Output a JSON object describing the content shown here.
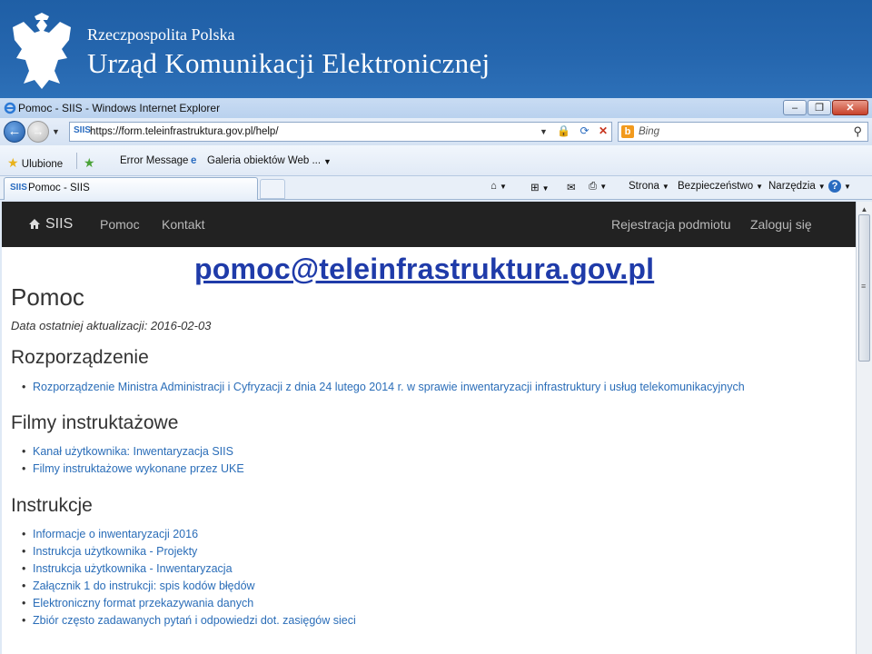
{
  "banner": {
    "subtitle": "Rzeczpospolita Polska",
    "title": "Urząd Komunikacji Elektronicznej"
  },
  "browser": {
    "window_title": "Pomoc - SIIS - Windows Internet Explorer",
    "address_url": "https://form.teleinfrastruktura.gov.pl/help/",
    "search_placeholder": "Bing",
    "favorites": {
      "label": "Ulubione",
      "items": [
        "Error Message",
        "Galeria obiektów Web ..."
      ]
    },
    "tab_title": "Pomoc - SIIS",
    "commands": [
      "Strona",
      "Bezpieczeństwo",
      "Narzędzia"
    ]
  },
  "site": {
    "nav": {
      "brand": "SIIS",
      "links": [
        "Pomoc",
        "Kontakt"
      ],
      "right_links": [
        "Rejestracja podmiotu",
        "Zaloguj się"
      ]
    },
    "callout_email": "pomoc@teleinfrastruktura.gov.pl",
    "heading": "Pomoc",
    "last_update": "Data ostatniej aktualizacji: 2016-02-03",
    "sections": [
      {
        "title": "Rozporządzenie",
        "links": [
          "Rozporządzenie Ministra Administracji i Cyfryzacji z dnia 24 lutego 2014 r. w sprawie inwentaryzacji infrastruktury i usług telekomunikacyjnych"
        ]
      },
      {
        "title": "Filmy instruktażowe",
        "links": [
          "Kanał użytkownika: Inwentaryzacja SIIS",
          "Filmy instruktażowe wykonane przez UKE"
        ]
      },
      {
        "title": "Instrukcje",
        "links": [
          "Informacje o inwentaryzacji 2016",
          "Instrukcja użytkownika - Projekty",
          "Instrukcja użytkownika - Inwentaryzacja",
          "Załącznik 1 do instrukcji: spis kodów błędów",
          "Elektroniczny format przekazywania danych",
          "Zbiór często zadawanych pytań i odpowiedzi dot. zasięgów sieci"
        ]
      }
    ]
  },
  "colors": {
    "banner_blue": "#2566ae",
    "site_nav_bg": "#222222",
    "link_blue": "#2a6db8",
    "callout_blue": "#1f3ba9"
  }
}
